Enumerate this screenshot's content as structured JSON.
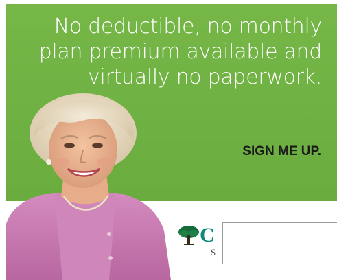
{
  "ad": {
    "headline_lines": [
      "No deductible, no monthly",
      "plan premium available and",
      "virtually no paperwork."
    ],
    "cta_label": "SIGN ME UP.",
    "logo": {
      "visible_letter": "C",
      "visible_subtext": "S"
    },
    "colors": {
      "panel_green": "#70b243",
      "cta_text": "#1b1b1b",
      "logo_teal": "#0d8a7a",
      "cardigan_pink": "#c979b2"
    },
    "icons": [
      "tree-logo-icon"
    ]
  }
}
